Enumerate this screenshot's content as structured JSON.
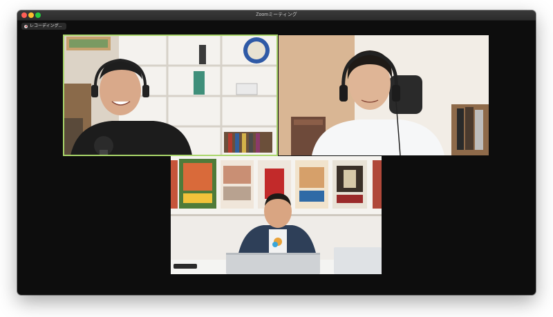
{
  "window": {
    "title": "Zoomミーティング"
  },
  "recording": {
    "label": "レコーディング..."
  },
  "participants": [
    {
      "id": "participant-1",
      "active_speaker": true
    },
    {
      "id": "participant-2",
      "active_speaker": false
    },
    {
      "id": "participant-3",
      "active_speaker": false
    }
  ],
  "icons": {
    "recording": "record-icon"
  },
  "colors": {
    "active_speaker_border": "#a9d66a",
    "window_bg": "#0d0d0d",
    "record_red": "#d0202a"
  }
}
